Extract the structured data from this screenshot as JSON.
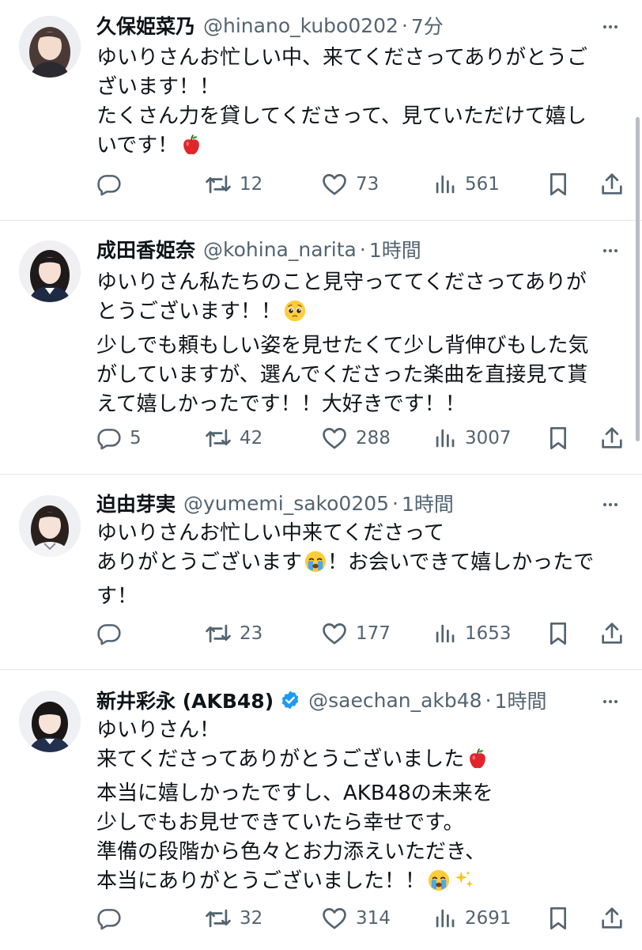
{
  "tweets": [
    {
      "name": "久保姫菜乃",
      "handle": "@hinano_kubo0202",
      "separator": "·",
      "time": "7分",
      "verified": false,
      "lines": [
        "ゆいりさんお忙しい中、来てくださってありがとうご",
        "ざいます！！",
        "たくさん力を貸してくださって、見ていただけて嬉し",
        "いです！"
      ],
      "emoji": [
        {
          "line": 3,
          "name": "red-apple-icon"
        }
      ],
      "reply_count": "",
      "retweet_count": "12",
      "like_count": "73",
      "view_count": "561"
    },
    {
      "name": "成田香姫奈",
      "handle": "@kohina_narita",
      "separator": "·",
      "time": "1時間",
      "verified": false,
      "lines": [
        "ゆいりさん私たちのこと見守っててくださってありが",
        "とうございます！！",
        "少しでも頼もしい姿を見せたくて少し背伸びもした気",
        "がしていますが、選んでくださった楽曲を直接見て貰",
        "えて嬉しかったです！！大好きです！！"
      ],
      "emoji": [
        {
          "line": 1,
          "name": "pleading-face-icon"
        }
      ],
      "reply_count": "5",
      "retweet_count": "42",
      "like_count": "288",
      "view_count": "3007"
    },
    {
      "name": "迫由芽実",
      "handle": "@yumemi_sako0205",
      "separator": "·",
      "time": "1時間",
      "verified": false,
      "lines": [
        "ゆいりさんお忙しい中来てくださって",
        "ありがとうございます",
        "！お会いできて嬉しかったで",
        "す！"
      ],
      "emoji": [
        {
          "line": 1,
          "name": "crying-face-icon"
        }
      ],
      "reply_count": "",
      "retweet_count": "23",
      "like_count": "177",
      "view_count": "1653"
    },
    {
      "name": "新井彩永 (AKB48)",
      "handle": "@saechan_akb48",
      "separator": "·",
      "time": "1時間",
      "verified": true,
      "lines": [
        "ゆいりさん！",
        "来てくださってありがとうございました",
        "本当に嬉しかったですし、AKB48の未来を",
        "少しでもお見せできていたら幸せです。",
        "準備の段階から色々とお力添えいただき、",
        "本当にありがとうございました！！"
      ],
      "emoji": [
        {
          "line": 1,
          "name": "red-apple-icon"
        },
        {
          "line": 5,
          "name": "crying-face-icon"
        },
        {
          "line": 5,
          "name": "sparkles-icon"
        }
      ],
      "reply_count": "",
      "retweet_count": "32",
      "like_count": "314",
      "view_count": "2691"
    }
  ],
  "colors": {
    "text": "#0f1419",
    "muted": "#536471",
    "verified": "#1d9bf0",
    "divider": "#e4e6e8"
  },
  "icons": [
    "reply-icon",
    "retweet-icon",
    "like-icon",
    "views-icon",
    "bookmark-icon",
    "share-icon",
    "more-icon",
    "verified-badge-icon"
  ]
}
